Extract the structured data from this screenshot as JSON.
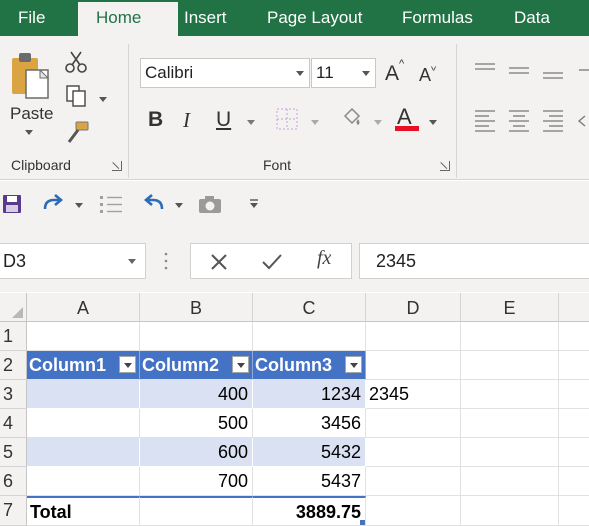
{
  "tabs": [
    {
      "label": "File"
    },
    {
      "label": "Home",
      "active": true
    },
    {
      "label": "Insert"
    },
    {
      "label": "Page Layout"
    },
    {
      "label": "Formulas"
    },
    {
      "label": "Data"
    }
  ],
  "ribbon": {
    "clipboard": {
      "paste_label": "Paste",
      "group_label": "Clipboard"
    },
    "font": {
      "font_name": "Calibri",
      "font_size": "11",
      "group_label": "Font",
      "bold_glyph": "B",
      "italic_glyph": "I",
      "underline_glyph": "U",
      "grow_glyph": "A",
      "shrink_glyph": "A",
      "font_color_glyph": "A",
      "font_color": "#e81123"
    }
  },
  "formula_bar": {
    "name_box": "D3",
    "fx_label": "fx",
    "value": "2345"
  },
  "sheet": {
    "columns": [
      "A",
      "B",
      "C",
      "D",
      "E"
    ],
    "rows": [
      "1",
      "2",
      "3",
      "4",
      "5",
      "6",
      "7"
    ],
    "table": {
      "headers": [
        "Column1",
        "Column2",
        "Column3"
      ],
      "rows": [
        {
          "a": "",
          "b": "400",
          "c": "1234"
        },
        {
          "a": "",
          "b": "500",
          "c": "3456"
        },
        {
          "a": "",
          "b": "600",
          "c": "5432"
        },
        {
          "a": "",
          "b": "700",
          "c": "5437"
        }
      ],
      "total_label": "Total",
      "total_value": "3889.75"
    },
    "d3_value": "2345",
    "header_color": "#4472c4",
    "band_color": "#d9e1f2"
  },
  "theme": {
    "accent": "#217346"
  }
}
